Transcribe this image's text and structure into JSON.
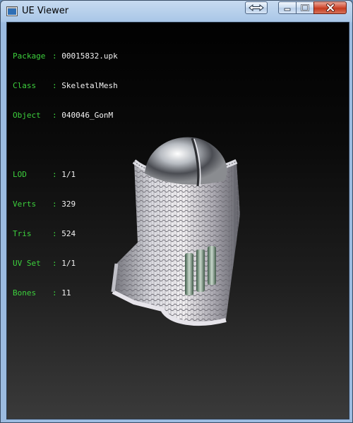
{
  "window": {
    "title": "UE Viewer"
  },
  "info": {
    "rows_top": [
      {
        "label": "Package",
        "value": "00015832.upk"
      },
      {
        "label": "Class",
        "value": "SkeletalMesh"
      },
      {
        "label": "Object",
        "value": "040046_GonM"
      }
    ],
    "rows_bottom": [
      {
        "label": "LOD",
        "value": "1/1"
      },
      {
        "label": "Verts",
        "value": "329"
      },
      {
        "label": "Tris",
        "value": "524"
      },
      {
        "label": "UV Set",
        "value": "1/1"
      },
      {
        "label": "Bones",
        "value": "11"
      }
    ],
    "separator": ":"
  },
  "colors": {
    "label_green": "#3dd13d",
    "value_white": "#f2f2f2",
    "viewport_top": "#010101",
    "viewport_bottom": "#3a3a3a"
  },
  "icons": {
    "app": "ue-viewer-icon",
    "swap": "swap-arrows-icon",
    "minimize": "minimize-icon",
    "maximize": "maximize-icon",
    "close": "close-icon"
  }
}
